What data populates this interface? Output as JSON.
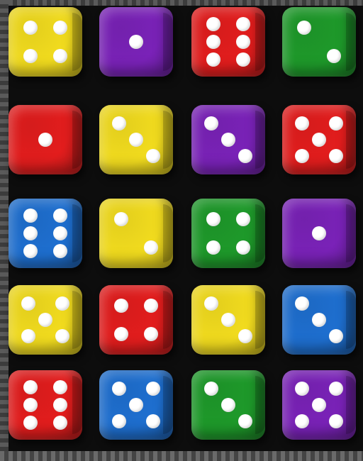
{
  "colors": {
    "yellow": "#f2dc1e",
    "purple": "#7a22b8",
    "red": "#e31d1d",
    "green": "#1e9a2a",
    "blue": "#1e6fd0",
    "tray": "#0d0d0d"
  },
  "dice": [
    {
      "row": 0,
      "col": 0,
      "color": "yellow",
      "face": 4
    },
    {
      "row": 0,
      "col": 1,
      "color": "purple",
      "face": 1
    },
    {
      "row": 0,
      "col": 2,
      "color": "red",
      "face": 6
    },
    {
      "row": 0,
      "col": 3,
      "color": "green",
      "face": 2
    },
    {
      "row": 1,
      "col": 0,
      "color": "red",
      "face": 1
    },
    {
      "row": 1,
      "col": 1,
      "color": "yellow",
      "face": 3
    },
    {
      "row": 1,
      "col": 2,
      "color": "purple",
      "face": 3
    },
    {
      "row": 1,
      "col": 3,
      "color": "red",
      "face": 5
    },
    {
      "row": 2,
      "col": 0,
      "color": "blue",
      "face": 6
    },
    {
      "row": 2,
      "col": 1,
      "color": "yellow",
      "face": 2
    },
    {
      "row": 2,
      "col": 2,
      "color": "green",
      "face": 4
    },
    {
      "row": 2,
      "col": 3,
      "color": "purple",
      "face": 1
    },
    {
      "row": 3,
      "col": 0,
      "color": "yellow",
      "face": 5
    },
    {
      "row": 3,
      "col": 1,
      "color": "red",
      "face": 4
    },
    {
      "row": 3,
      "col": 2,
      "color": "yellow",
      "face": 3
    },
    {
      "row": 3,
      "col": 3,
      "color": "blue",
      "face": 3
    },
    {
      "row": 4,
      "col": 0,
      "color": "red",
      "face": 6
    },
    {
      "row": 4,
      "col": 1,
      "color": "blue",
      "face": 5
    },
    {
      "row": 4,
      "col": 2,
      "color": "green",
      "face": 3
    },
    {
      "row": 4,
      "col": 3,
      "color": "purple",
      "face": 5
    }
  ]
}
